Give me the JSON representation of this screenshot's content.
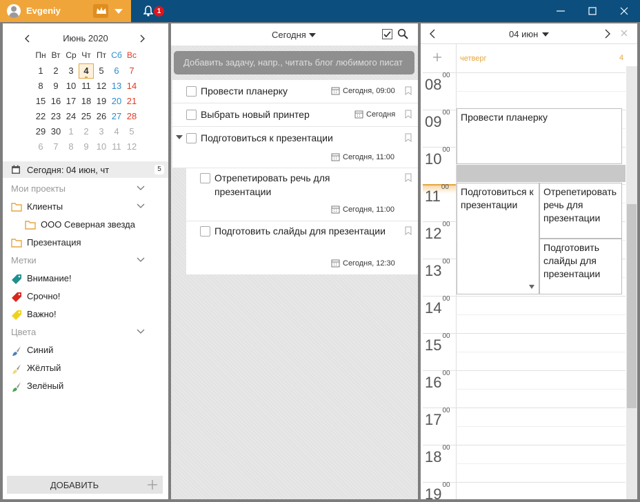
{
  "titlebar": {
    "username": "Evgeniy",
    "notifications": "1"
  },
  "calendar": {
    "month_label": "Июнь 2020",
    "weekdays": [
      "Пн",
      "Вт",
      "Ср",
      "Чт",
      "Пт",
      "Сб",
      "Вс"
    ],
    "weeks": [
      [
        "1",
        "2",
        "3",
        "4",
        "5",
        "6",
        "7"
      ],
      [
        "8",
        "9",
        "10",
        "11",
        "12",
        "13",
        "14"
      ],
      [
        "15",
        "16",
        "17",
        "18",
        "19",
        "20",
        "21"
      ],
      [
        "22",
        "23",
        "24",
        "25",
        "26",
        "27",
        "28"
      ],
      [
        "29",
        "30",
        "1",
        "2",
        "3",
        "4",
        "5"
      ],
      [
        "6",
        "7",
        "8",
        "9",
        "10",
        "11",
        "12"
      ]
    ],
    "today": "4"
  },
  "nav": {
    "today_label": "Сегодня: 04 июн, чт",
    "today_count": "5",
    "projects_header": "Мои проекты",
    "projects": [
      "Клиенты",
      "ООО Северная звезда",
      "Презентация"
    ],
    "tags_header": "Метки",
    "tags": [
      "Внимание!",
      "Срочно!",
      "Важно!"
    ],
    "colors_header": "Цвета",
    "colors": [
      "Синий",
      "Жёлтый",
      "Зелёный"
    ],
    "add_label": "ДОБАВИТЬ",
    "tag_colors": [
      "#1e8f8f",
      "#d7261e",
      "#f0d21a"
    ],
    "color_colors": [
      "#4a7fc1",
      "#f0d97a",
      "#4aa35a"
    ]
  },
  "tasks": {
    "filter_label": "Сегодня",
    "add_placeholder": "Добавить задачу, напр., читать блог любимого писат",
    "items": [
      {
        "title": "Провести планерку",
        "date": "Сегодня, 09:00"
      },
      {
        "title": "Выбрать новый принтер",
        "date": "Сегодня"
      },
      {
        "title": "Подготовиться к презентации",
        "date": "Сегодня, 11:00"
      }
    ],
    "subitems": [
      {
        "title": "Отрепетировать речь для презентации",
        "date": "Сегодня, 11:00"
      },
      {
        "title": "Подготовить слайды для презентации",
        "date": "Сегодня, 12:30"
      }
    ]
  },
  "dayview": {
    "date_label": "04 июн",
    "weekday": "четверг",
    "day_number": "4",
    "hours": [
      "08",
      "09",
      "10",
      "11",
      "12",
      "13",
      "14",
      "15",
      "16",
      "17",
      "18",
      "19"
    ],
    "minutes": "00",
    "events": [
      "Провести планерку",
      "Подготовиться к презентации",
      "Отрепетировать речь для презентации",
      "Подготовить слайды для презентации"
    ]
  }
}
